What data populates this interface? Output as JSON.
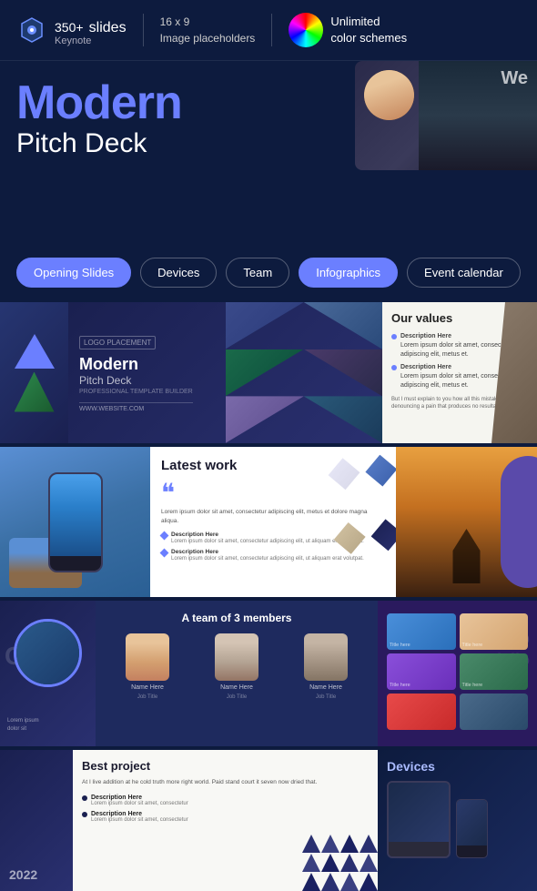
{
  "header": {
    "slides_count": "350+",
    "slides_label": "slides",
    "slides_sub": "Keynote",
    "format": "16 x 9",
    "format_sub": "Image placeholders",
    "color_label": "Unlimited\ncolor schemes",
    "color_line1": "Unlimited",
    "color_line2": "color schemes"
  },
  "hero": {
    "title_line1": "Modern",
    "title_line2": "Pitch Deck",
    "preview_text": "We"
  },
  "tags": [
    {
      "label": "Opening Slides",
      "active": true
    },
    {
      "label": "Devices",
      "active": false
    },
    {
      "label": "Team",
      "active": false
    },
    {
      "label": "Infographics",
      "active": true
    },
    {
      "label": "Event calendar",
      "active": false
    }
  ],
  "slides": {
    "row1": {
      "main_title": "Modern",
      "main_subtitle": "Pitch Deck",
      "main_sub2": "PROFESSIONAL TEMPLATE BUILDER",
      "logo_text": "LOGO PLACEMENT",
      "url_text": "WWW.WEBSITE.COM",
      "values_title": "Our values",
      "value1_title": "Description Here",
      "value1_text": "Lorem ipsum dolor sit amet, consectetur adipiscing elit, metus et.",
      "value2_title": "Description Here",
      "value2_text": "Lorem ipsum dolor sit amet, consectetur adipiscing elit, metus et.",
      "values_extra": "But I must explain to you how all this mistaken idea of denouncing a pain that produces no resultant pleasure."
    },
    "row2": {
      "latest_title": "Latest work",
      "latest_text": "Lorem ipsum dolor sit amet, consectetur adipiscing elit, metus et dolore magna aliqua.",
      "item1_title": "Description Here",
      "item1_text": "Lorem ipsum dolor sit amet, consectetur adipiscing elit, ut aliquam erat volutpat.",
      "item2_title": "Description Here",
      "item2_text": "Lorem ipsum dolor sit amet, consectetur adipiscing elit, ut aliquam erat volutpat."
    },
    "row3": {
      "team_title": "A team of 3 members",
      "member1_name": "Name Here",
      "member1_role": "Job Title",
      "member2_name": "Name Here",
      "member2_role": "Job Title",
      "member3_name": "Name Here",
      "member3_role": "Job Title",
      "portfolio_label1": "Title here",
      "portfolio_label2": "Title here",
      "portfolio_label3": "Title here",
      "portfolio_label4": "Title here"
    },
    "row4": {
      "year": "2022",
      "best_title": "Best project",
      "best_desc": "At I live addition at he cold truth more right world. Paid stand court it seven now dried that.",
      "item1_title": "Description Here",
      "item1_text": "Lorem ipsum dolor sit amet, consectetur",
      "item2_title": "Description Here",
      "item2_text": "Lorem ipsum dolor sit amet, consectetur",
      "devices_title": "Devices"
    }
  }
}
